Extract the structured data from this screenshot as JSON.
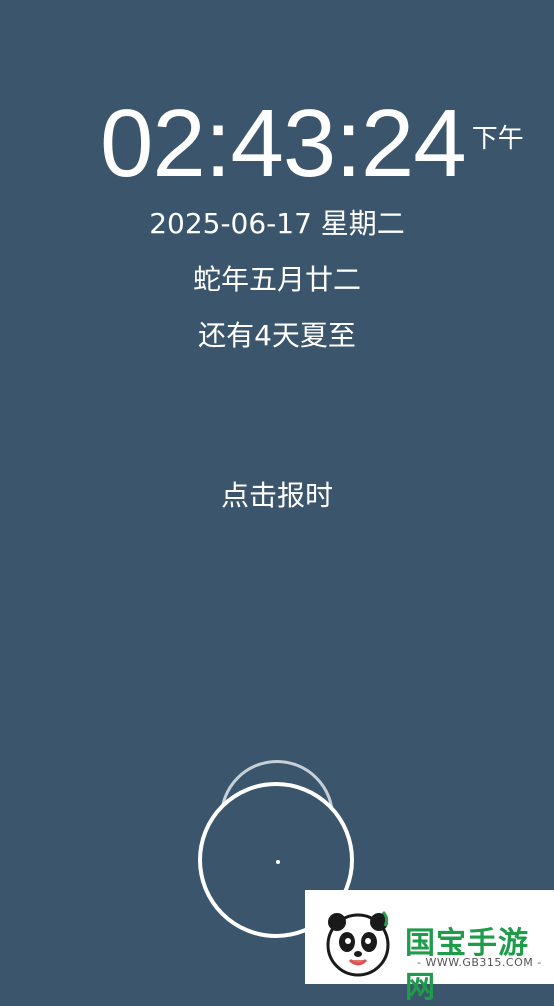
{
  "clock": {
    "time": "02:43:24",
    "ampm": "下午",
    "date": "2025-06-17 星期二",
    "lunar": "蛇年五月廿二",
    "solar_term": "还有4天夏至",
    "chime_label": "点击报时"
  },
  "watermark": {
    "title": "国宝手游网",
    "url": "- WWW.GB315.COM -"
  },
  "colors": {
    "background": "#3b566c",
    "text": "#ffffff",
    "watermark_green": "#1f9c4a"
  }
}
